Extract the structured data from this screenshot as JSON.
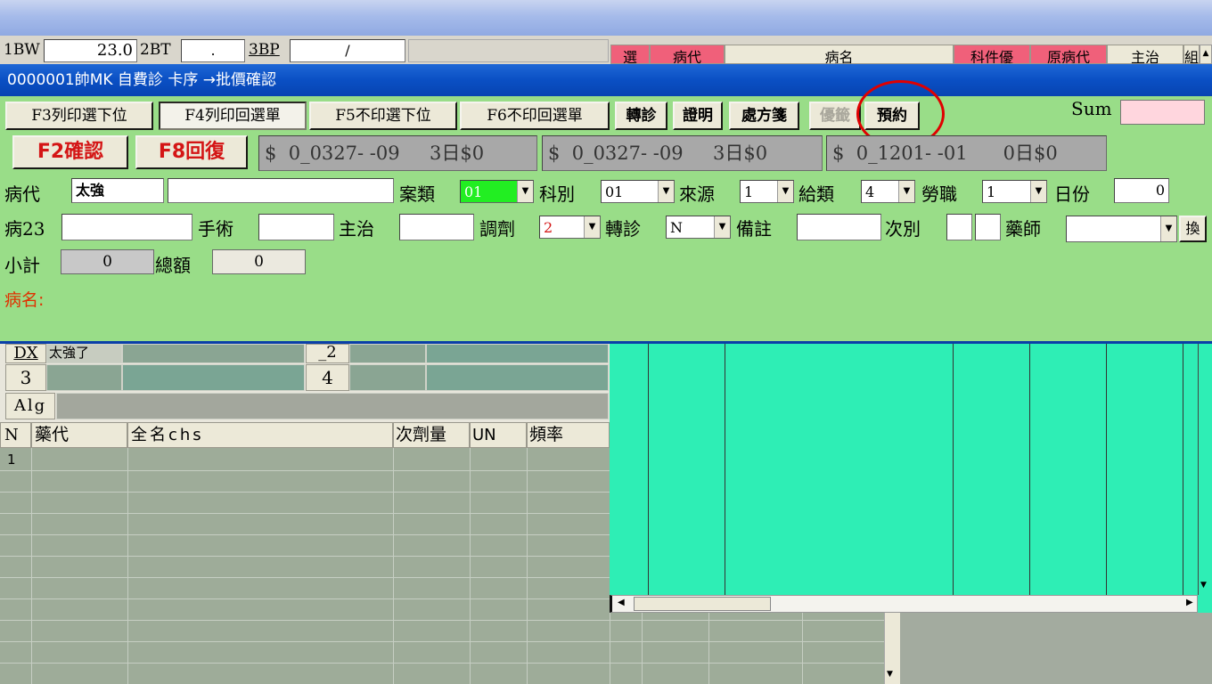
{
  "top_row": {
    "bw_label": "1BW",
    "bw_value": "23.0",
    "bt_label": "2BT",
    "bt_value": ".",
    "bp_label": "3BP",
    "bp_value": "/",
    "grid_headers": [
      "選",
      "病代",
      "病名",
      "科件優",
      "原病代",
      "主治",
      "組"
    ]
  },
  "dialog": {
    "title": "0000001帥MK 自費診  卡序   →批價確認",
    "buttons": {
      "f3": "F3列印選下位",
      "f4": "F4列印回選單",
      "f5": "F5不印選下位",
      "f6": "F6不印回選單",
      "transfer": "轉診",
      "certificate": "證明",
      "prescription": "處方箋",
      "preferential": "優籤",
      "appointment": "預約",
      "f2": "F2確認",
      "f8": "F8回復",
      "swap": "換"
    },
    "sum_label": "Sum",
    "sum_value": "",
    "price_boxes": [
      "$  0_0327- -09     3日$0",
      "$  0_0327- -09     3日$0",
      "$  0_1201- -01      0日$0"
    ],
    "row1": {
      "disease_code_label": "病代",
      "disease_code_value": "太強",
      "disease_name_value": "",
      "case_type_label": "案類",
      "case_type_value": "01",
      "dept_label": "科別",
      "dept_value": "01",
      "source_label": "來源",
      "source_value": "1",
      "pay_type_label": "給類",
      "pay_type_value": "4",
      "labor_label": "勞職",
      "labor_value": "1",
      "days_label": "日份",
      "days_value": "0"
    },
    "row2": {
      "disease23_label": "病23",
      "disease23_value": "",
      "surgery_label": "手術",
      "surgery_value": "",
      "doctor_label": "主治",
      "doctor_value": "",
      "dispense_label": "調劑",
      "dispense_value": "2",
      "referral_label": "轉診",
      "referral_value": "N",
      "note_label": "備註",
      "note_value": "",
      "visit_label": "次別",
      "visit_value1": "",
      "visit_value2": "",
      "pharmacist_label": "藥師",
      "pharmacist_value": ""
    },
    "row3": {
      "subtotal_label": "小計",
      "subtotal_value": "0",
      "total_label": "總額",
      "total_value": "0"
    },
    "disease_name_caption": "病名:"
  },
  "lower": {
    "dx_label": "DX",
    "dx_value": "太強了",
    "dx2_label": "_2",
    "row3_label": "3",
    "row4_label": "4",
    "alg_label": "Alg",
    "med_headers": [
      "N",
      "藥代",
      "全名chs",
      "次劑量",
      "UN",
      "頻率"
    ],
    "first_row_number": "1"
  },
  "colors": {
    "dialog_bg": "#99dd88",
    "teal_panel": "#2eeeb5",
    "highlight_circle": "#e00000",
    "case_type_bg": "#22ee22"
  }
}
